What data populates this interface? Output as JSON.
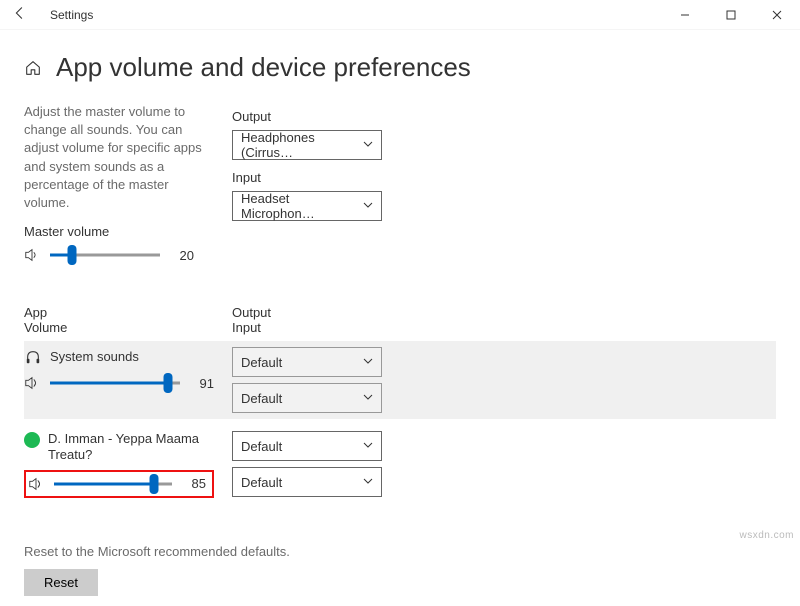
{
  "titlebar": {
    "title": "Settings"
  },
  "page": {
    "title": "App volume and device preferences"
  },
  "description": "Adjust the master volume to change all sounds. You can adjust volume for specific apps and system sounds as a percentage of the master volume.",
  "master": {
    "label": "Master volume",
    "value": 20
  },
  "output": {
    "label": "Output",
    "selected": "Headphones (Cirrus…"
  },
  "input": {
    "label": "Input",
    "selected": "Headset Microphon…"
  },
  "columns": {
    "app": "App\nVolume",
    "oi": "Output\nInput"
  },
  "apps": [
    {
      "name": "System sounds",
      "volume": 91,
      "output": "Default",
      "input": "Default",
      "icon": "headphones",
      "highlighted": true
    },
    {
      "name": "D. Imman - Yeppa Maama Treatu?",
      "volume": 85,
      "output": "Default",
      "input": "Default",
      "icon": "spotify",
      "highlighted": false,
      "boxed": true
    }
  ],
  "reset": {
    "text": "Reset to the Microsoft recommended defaults.",
    "button": "Reset"
  },
  "watermark": "wsxdn.com"
}
